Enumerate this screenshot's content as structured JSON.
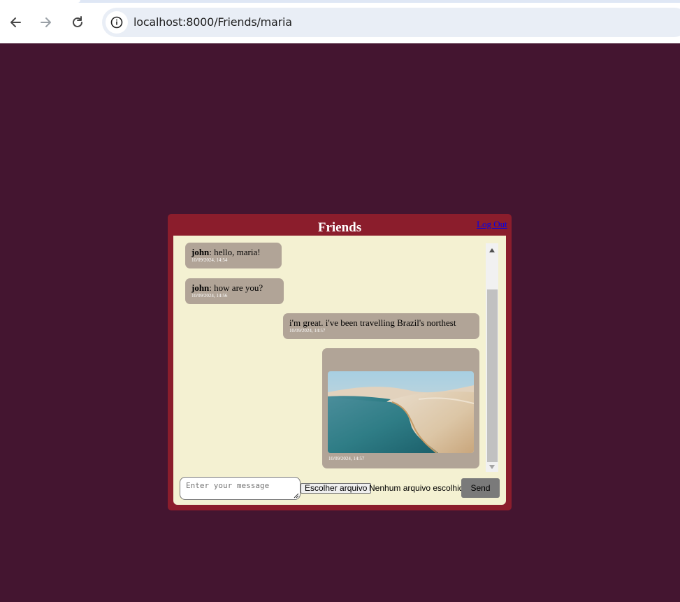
{
  "browser": {
    "url": "localhost:8000/Friends/maria",
    "back_icon": "arrow-left-icon",
    "forward_icon": "arrow-right-icon",
    "reload_icon": "reload-icon",
    "info_icon": "info-icon"
  },
  "chat": {
    "title": "Friends",
    "logout_label": "Log Out",
    "messages": [
      {
        "sender": "john",
        "separator": ": ",
        "text": "hello, maria!",
        "time": "10/09/2024, 14:54",
        "from_self": false
      },
      {
        "sender": "john",
        "separator": ": ",
        "text": "how are you?",
        "time": "10/09/2024, 14:56",
        "from_self": false
      },
      {
        "sender": "",
        "text": "i'm great. i've been travelling Brazil's northest",
        "time": "10/09/2024, 14:57",
        "from_self": true
      },
      {
        "sender": "",
        "text": "",
        "image": "photo of turquoise lagoon between sand dunes",
        "time": "10/09/2024, 14:57",
        "from_self": true
      }
    ],
    "composer": {
      "placeholder": "Enter your message",
      "file_button_label": "Escolher arquivo",
      "file_status": "Nenhum arquivo escolhido",
      "send_label": "Send"
    }
  },
  "colors": {
    "page_background": "#441530",
    "panel": "#8b1d2c",
    "chat_background": "#f4f1d2",
    "bubble": "#b1a497",
    "send_button": "#7a7a7a"
  }
}
